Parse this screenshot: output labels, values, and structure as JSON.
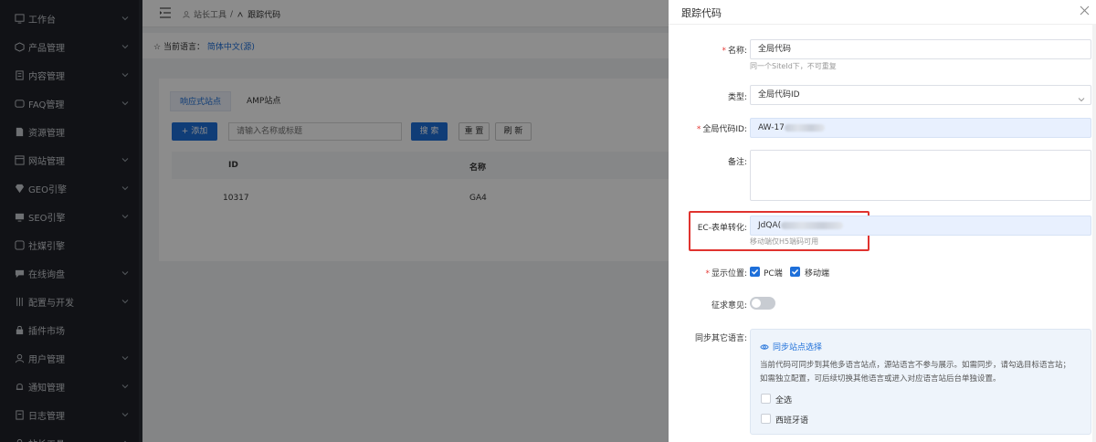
{
  "sidebar": {
    "items": [
      {
        "label": "工作台",
        "icon": "dashboard-icon",
        "has_chevron": true
      },
      {
        "label": "产品管理",
        "icon": "product-icon",
        "has_chevron": true
      },
      {
        "label": "内容管理",
        "icon": "content-icon",
        "has_chevron": true
      },
      {
        "label": "FAQ管理",
        "icon": "faq-icon",
        "has_chevron": true
      },
      {
        "label": "资源管理",
        "icon": "resource-icon",
        "has_chevron": false
      },
      {
        "label": "网站管理",
        "icon": "website-icon",
        "has_chevron": true
      },
      {
        "label": "GEO引擎",
        "icon": "geo-icon",
        "has_chevron": true
      },
      {
        "label": "SEO引擎",
        "icon": "seo-icon",
        "has_chevron": true
      },
      {
        "label": "社媒引擎",
        "icon": "social-icon",
        "has_chevron": false
      },
      {
        "label": "在线询盘",
        "icon": "chat-icon",
        "has_chevron": true
      },
      {
        "label": "配置与开发",
        "icon": "config-icon",
        "has_chevron": true
      },
      {
        "label": "插件市场",
        "icon": "plugin-icon",
        "has_chevron": false
      },
      {
        "label": "用户管理",
        "icon": "user-icon",
        "has_chevron": true
      },
      {
        "label": "通知管理",
        "icon": "notify-icon",
        "has_chevron": true
      },
      {
        "label": "日志管理",
        "icon": "log-icon",
        "has_chevron": true
      },
      {
        "label": "站长工具",
        "icon": "webmaster-icon",
        "has_chevron": true
      }
    ]
  },
  "topbar": {
    "breadcrumb": [
      "站长工具",
      "/",
      "跟踪代码"
    ]
  },
  "langbar": {
    "label": "当前语言：",
    "value": "简体中文(源)"
  },
  "list": {
    "tabs": [
      "响应式站点",
      "AMP站点"
    ],
    "add_label": "+ 添加",
    "search_placeholder": "请输入名称或标题",
    "search_label": "搜 索",
    "reset_label": "重 置",
    "refresh_label": "刷 新",
    "columns": [
      "ID",
      "名称"
    ],
    "rows": [
      {
        "id": "10317",
        "name": "GA4"
      }
    ]
  },
  "drawer": {
    "title": "跟踪代码",
    "fields": {
      "name_label": "名称:",
      "name_value": "全局代码",
      "name_hint": "同一个SiteId下，不可重复",
      "type_label": "类型:",
      "type_value": "全局代码ID",
      "global_id_label": "全局代码ID:",
      "global_id_value": "AW-17",
      "note_label": "备注:",
      "ec_label": "EC-表单转化:",
      "ec_value": "JdQA(",
      "ec_hint": "移动端仅H5端码可用",
      "position_label": "显示位置:",
      "position_pc": "PC端",
      "position_mobile": "移动端",
      "feedback_label": "征求意见:",
      "sync_label": "同步其它语言:",
      "sync_link": "同步站点选择",
      "sync_desc": "当前代码可同步到其他多语言站点，源站语言不参与展示。如需同步，请勾选目标语言站；如需独立配置，可后续切换其他语言或进入对应语言站后台单独设置。",
      "select_all": "全选",
      "lang_spanish": "西班牙语"
    }
  },
  "colors": {
    "accent": "#1e6fd9",
    "sidebar_bg": "#1f2228",
    "required": "#e53935",
    "highlight_box": "#e0332f"
  }
}
